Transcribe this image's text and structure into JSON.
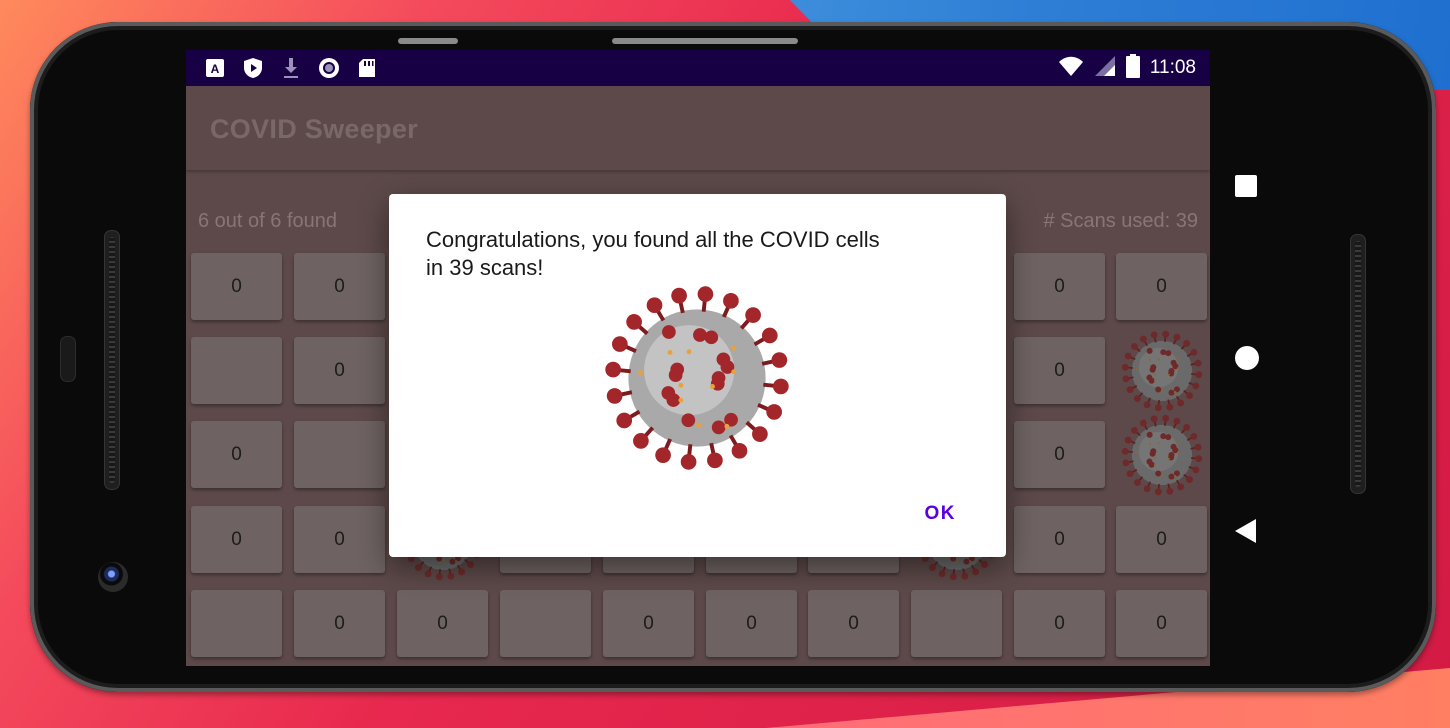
{
  "status_bar": {
    "time": "11:08",
    "left_icons": [
      "font-a-icon",
      "shield-play-icon",
      "download-icon",
      "circle-record-icon",
      "sd-card-icon"
    ],
    "right_icons": [
      "wifi-icon",
      "signal-icon",
      "battery-icon"
    ]
  },
  "app": {
    "title": "COVID Sweeper",
    "found_status": "6 out of 6 found",
    "scans_status": "# Scans used: 39"
  },
  "grid": {
    "rows": [
      [
        "0",
        "0",
        "",
        "",
        "",
        "",
        "",
        "",
        "0",
        "0"
      ],
      [
        "",
        "0",
        "",
        "",
        "",
        "",
        "",
        "",
        "0",
        "virus"
      ],
      [
        "0",
        "",
        "",
        "",
        "",
        "",
        "",
        "",
        "0",
        "virus"
      ],
      [
        "0",
        "0",
        "virus",
        "",
        "",
        "",
        "",
        "virus",
        "0",
        "0"
      ],
      [
        "",
        "0",
        "0",
        "",
        "0",
        "0",
        "0",
        "",
        "0",
        "0"
      ]
    ]
  },
  "dialog": {
    "message": "Congratulations, you found all the COVID cells in 39 scans!",
    "image": "coronavirus-image",
    "ok_label": "OK"
  },
  "nav": {
    "buttons": [
      "recents-square-icon",
      "home-circle-icon",
      "back-triangle-icon"
    ]
  },
  "colors": {
    "status_bar": "#170044",
    "dimmed_app": "#5d4949",
    "accent": "#5a00e0"
  }
}
